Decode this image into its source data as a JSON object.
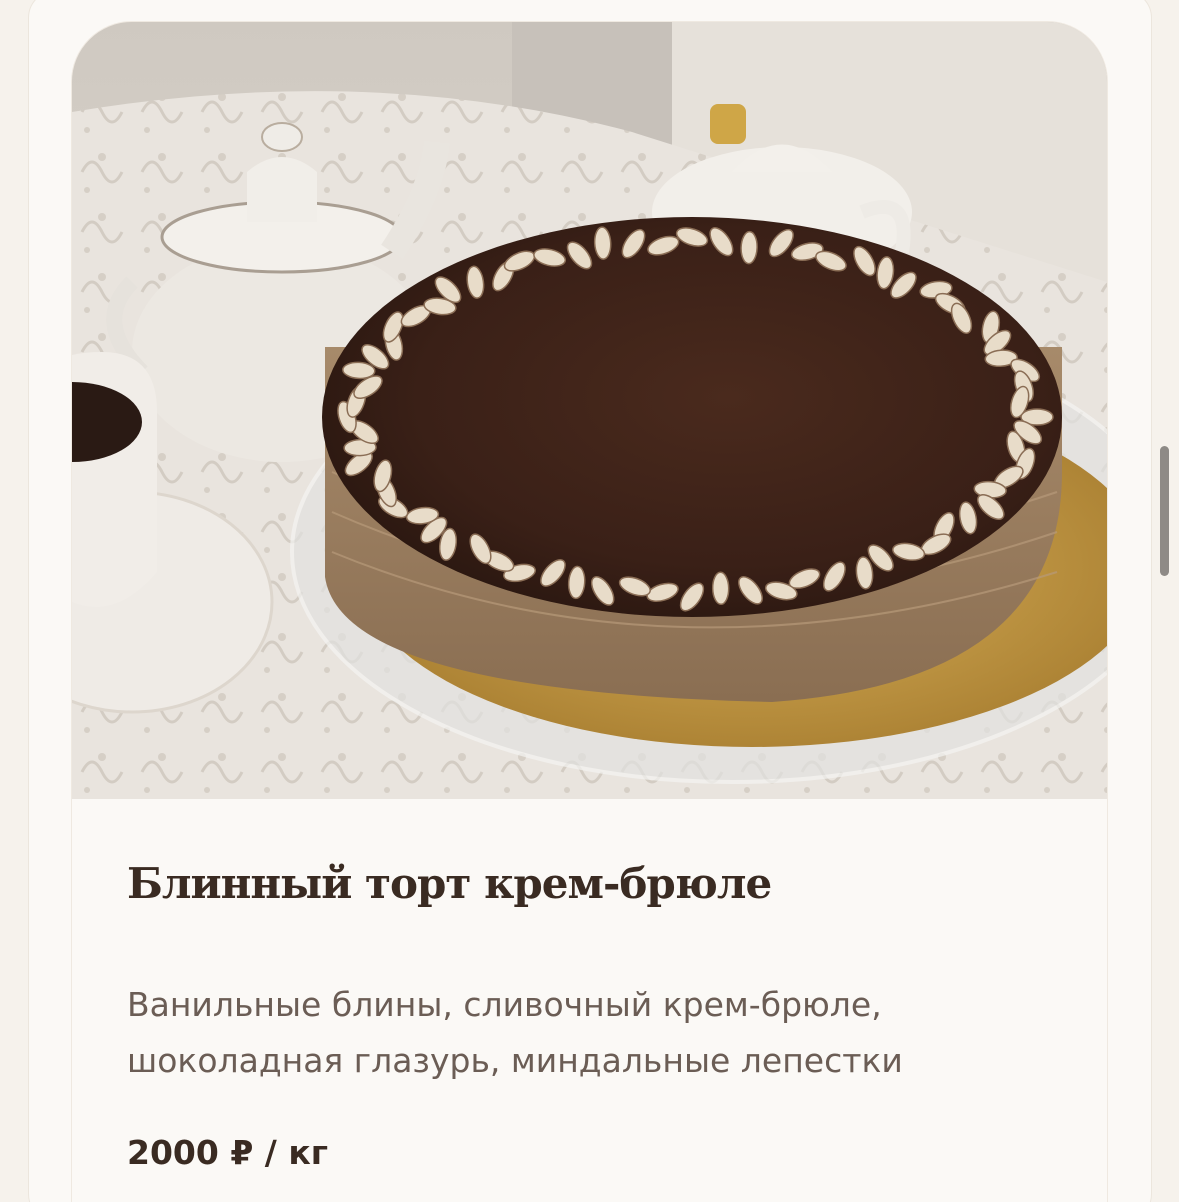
{
  "product": {
    "name": "Блинный торт крем-брюле",
    "description_lines": [
      "Ванильные блины, сливочный крем-брюле,",
      "шоколадная глазурь, миндальные лепестки"
    ],
    "price": "2000 ₽ / кг"
  },
  "colors": {
    "background": "#f6f2ec",
    "card": "#fbf9f6",
    "title_text": "#3a2b22",
    "body_text": "#6b5d55"
  }
}
